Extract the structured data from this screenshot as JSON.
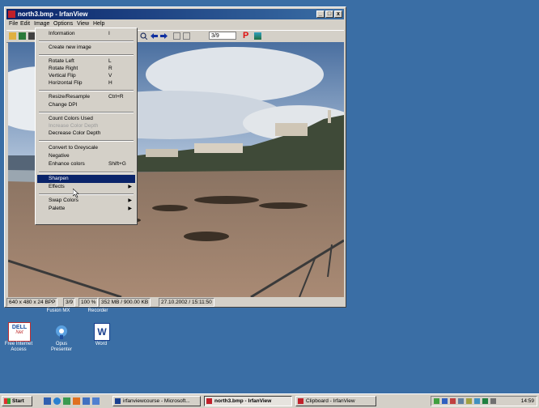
{
  "window": {
    "title": "north3.bmp - IrfanView",
    "controls": {
      "minimize": "_",
      "maximize": "□",
      "close": "x"
    }
  },
  "menubar": [
    "File",
    "Edit",
    "Image",
    "Options",
    "View",
    "Help"
  ],
  "toolbar": {
    "page_value": "3/9",
    "p_label": "P"
  },
  "image_menu": {
    "items": [
      {
        "label": "Information",
        "shortcut": "I"
      },
      {
        "label": "Create new image",
        "shortcut": ""
      },
      {
        "label": "Rotate Left",
        "shortcut": "L"
      },
      {
        "label": "Rotate Right",
        "shortcut": "R"
      },
      {
        "label": "Vertical Flip",
        "shortcut": "V"
      },
      {
        "label": "Horizontal Flip",
        "shortcut": "H"
      },
      {
        "label": "Resize/Resample",
        "shortcut": "Ctrl+R"
      },
      {
        "label": "Change DPI",
        "shortcut": ""
      },
      {
        "label": "Count Colors Used",
        "shortcut": ""
      },
      {
        "label": "Increase Color Depth",
        "shortcut": ""
      },
      {
        "label": "Decrease Color Depth",
        "shortcut": ""
      },
      {
        "label": "Convert to Greyscale",
        "shortcut": ""
      },
      {
        "label": "Negative",
        "shortcut": ""
      },
      {
        "label": "Enhance colors",
        "shortcut": "Shift+G"
      },
      {
        "label": "Sharpen",
        "shortcut": ""
      },
      {
        "label": "Effects",
        "shortcut": ""
      },
      {
        "label": "Swap Colors",
        "shortcut": ""
      },
      {
        "label": "Palette",
        "shortcut": ""
      }
    ]
  },
  "statusbar": [
    "640 x 480 x 24 BPP",
    "3/9",
    "100 %",
    "352 MB / 900.00 KB",
    "27.10.2002 / 15:11:50"
  ],
  "desktop": {
    "top_labels": [
      "Fusion MX",
      "Recorder"
    ],
    "icons": [
      {
        "label1": "Free Internet",
        "label2": "Access"
      },
      {
        "label1": "Opus",
        "label2": "Presenter"
      },
      {
        "label1": "Word",
        "label2": ""
      }
    ],
    "dell_text": "DELL"
  },
  "taskbar": {
    "start": "Start",
    "tasks": [
      "irfanviewcourse - Microsoft...",
      "north3.bmp - IrfanView",
      "Clipboard - IrfanView"
    ],
    "clock": "14:59"
  }
}
